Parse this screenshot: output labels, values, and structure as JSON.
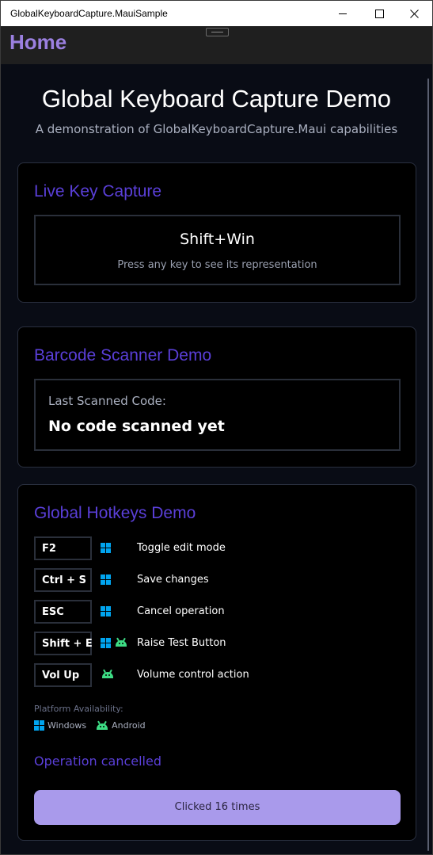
{
  "window": {
    "title": "GlobalKeyboardCapture.MauiSample",
    "controls": [
      "minimize",
      "maximize",
      "close"
    ]
  },
  "nav": {
    "title": "Home"
  },
  "header": {
    "title": "Global Keyboard Capture Demo",
    "subtitle": "A demonstration of GlobalKeyboardCapture.Maui capabilities"
  },
  "live_capture": {
    "title": "Live Key Capture",
    "current_key": "Shift+Win",
    "hint": "Press any key to see its representation"
  },
  "barcode": {
    "title": "Barcode Scanner Demo",
    "label": "Last Scanned Code:",
    "value": "No code scanned yet"
  },
  "hotkeys": {
    "title": "Global Hotkeys Demo",
    "rows": [
      {
        "key": "F2",
        "platforms": [
          "windows-icon"
        ],
        "description": "Toggle edit mode"
      },
      {
        "key": "Ctrl + S",
        "platforms": [
          "windows-icon"
        ],
        "description": "Save changes"
      },
      {
        "key": "ESC",
        "platforms": [
          "windows-icon"
        ],
        "description": "Cancel operation"
      },
      {
        "key": "Shift + E",
        "platforms": [
          "windows-icon",
          "android-icon"
        ],
        "description": "Raise Test Button"
      },
      {
        "key": "Vol Up",
        "platforms": [
          "android-icon"
        ],
        "description": "Volume control action"
      }
    ],
    "availability_label": "Platform Availability:",
    "availability": [
      {
        "icon": "windows-icon",
        "label": "Windows"
      },
      {
        "icon": "android-icon",
        "label": "Android"
      }
    ],
    "status": "Operation cancelled",
    "button_label": "Clicked 16 times"
  },
  "colors": {
    "accent": "#5a3fd8",
    "nav_title": "#9b80e0",
    "button": "#a99aeb",
    "windows": "#00a4ef",
    "android": "#3ddc84"
  }
}
